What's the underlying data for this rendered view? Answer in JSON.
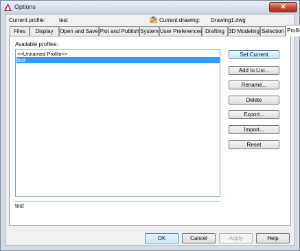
{
  "window": {
    "title": "Options",
    "close_glyph": "✕"
  },
  "header": {
    "current_profile_label": "Current profile:",
    "current_profile_value": "test",
    "current_drawing_label": "Current drawing:",
    "current_drawing_value": "Drawing1.dwg",
    "drawing_icon": "drawing-icon"
  },
  "tabs": [
    {
      "label": "Files"
    },
    {
      "label": "Display"
    },
    {
      "label": "Open and Save"
    },
    {
      "label": "Plot and Publish"
    },
    {
      "label": "System"
    },
    {
      "label": "User Preferences"
    },
    {
      "label": "Drafting"
    },
    {
      "label": "3D Modeling"
    },
    {
      "label": "Selection"
    },
    {
      "label": "Profiles",
      "active": true
    }
  ],
  "profiles": {
    "list_label": "Available profiles:",
    "items": [
      {
        "label": "<<Unnamed Profile>>",
        "selected": false
      },
      {
        "label": "test",
        "selected": true
      }
    ],
    "description": "test"
  },
  "buttons": {
    "set_current": "Set Current",
    "add_to_list": "Add to List...",
    "rename": "Rename...",
    "delete": "Delete",
    "export": "Export...",
    "import": "Import...",
    "reset": "Reset"
  },
  "footer": {
    "ok": "OK",
    "cancel": "Cancel",
    "apply": "Apply",
    "help": "Help"
  },
  "colors": {
    "selection": "#3399ff",
    "close_button": "#c5432f"
  }
}
